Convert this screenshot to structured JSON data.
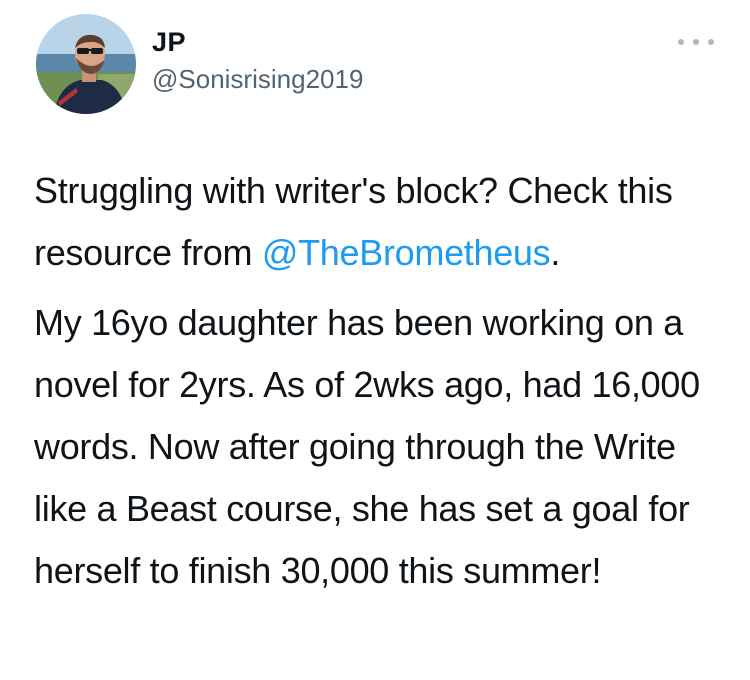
{
  "tweet": {
    "display_name": "JP",
    "handle": "@Sonisrising2019",
    "paragraph1": {
      "before": "Struggling with writer's block? Check this resource from ",
      "mention": "@TheBrometheus",
      "after": "."
    },
    "paragraph2": "My 16yo daughter has been working on a novel for 2yrs. As of 2wks ago, had 16,000 words. Now after going through the Write like a Beast course, she has set a goal for herself to finish 30,000 this summer!",
    "more_icon": "more-horizontal-icon"
  },
  "colors": {
    "mention": "#1d9bf0",
    "handle": "#536471",
    "text": "#0f1419",
    "more_dots": "#aab8c2"
  }
}
